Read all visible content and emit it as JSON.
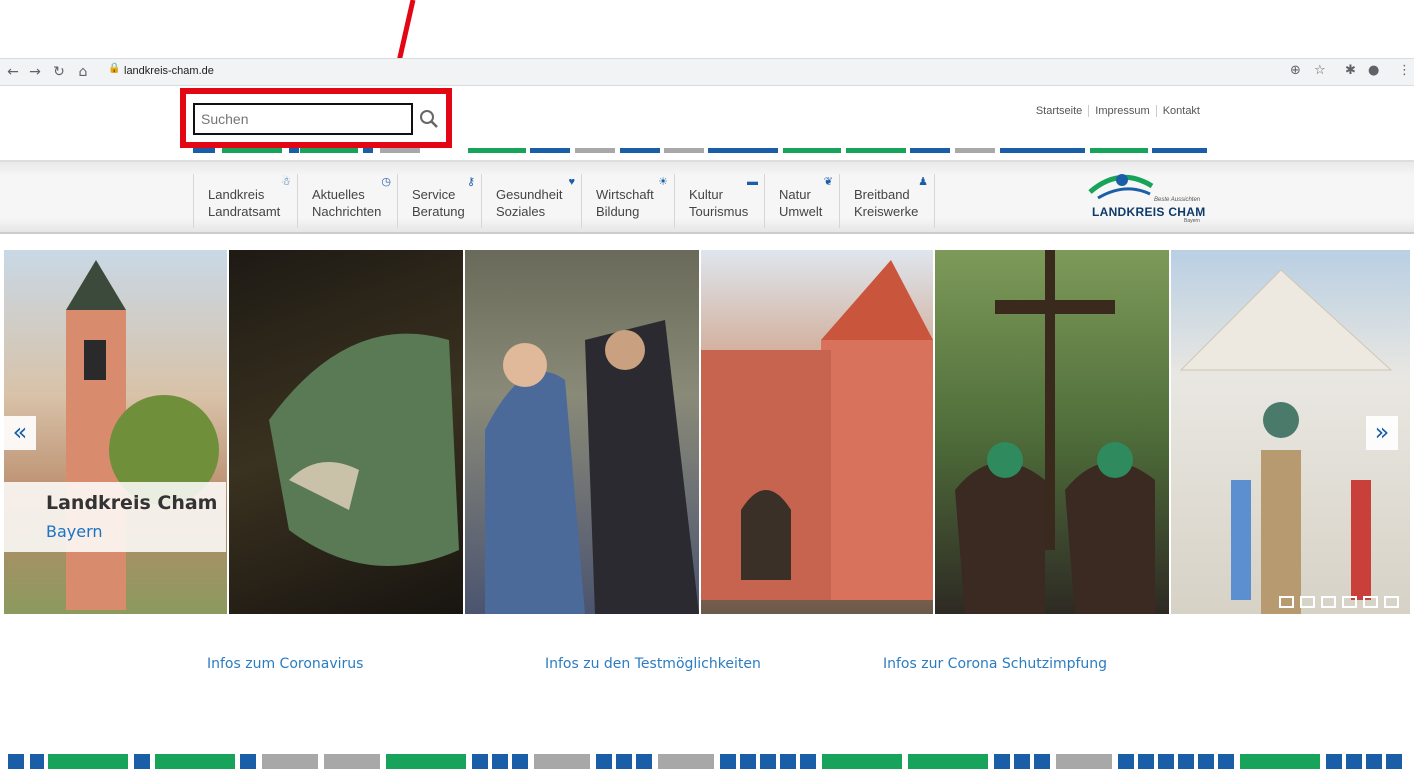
{
  "browser": {
    "url": "landkreis-cham.de"
  },
  "search": {
    "placeholder": "Suchen"
  },
  "top_links": [
    "Startseite",
    "Impressum",
    "Kontakt"
  ],
  "nav": [
    {
      "line1": "Landkreis",
      "line2": "Landratsamt",
      "icon": "person-icon"
    },
    {
      "line1": "Aktuelles",
      "line2": "Nachrichten",
      "icon": "clock-icon"
    },
    {
      "line1": "Service",
      "line2": "Beratung",
      "icon": "person-key-icon"
    },
    {
      "line1": "Gesundheit",
      "line2": "Soziales",
      "icon": "heart-icon"
    },
    {
      "line1": "Wirtschaft",
      "line2": "Bildung",
      "icon": "sun-icon"
    },
    {
      "line1": "Kultur",
      "line2": "Tourismus",
      "icon": "bed-icon"
    },
    {
      "line1": "Natur",
      "line2": "Umwelt",
      "icon": "leaf-icon"
    },
    {
      "line1": "Breitband",
      "line2": "Kreiswerke",
      "icon": "people-icon"
    }
  ],
  "logo": {
    "tagline": "Beste Aussichten",
    "name": "LANDKREIS CHAM",
    "region": "Bayern"
  },
  "slider": {
    "caption_title": "Landkreis Cham",
    "caption_subtitle": "Bayern",
    "prev": "«",
    "next": "»"
  },
  "info_links": [
    "Infos zum Coronavirus",
    "Infos zu den Testmöglichkeiten",
    "Infos zur Corona Schutzimpfung"
  ],
  "colors": {
    "brand_blue": "#1a5ea8",
    "brand_green": "#17a35a",
    "highlight_red": "#e30613",
    "stripe_gray": "#a8a8a8"
  }
}
